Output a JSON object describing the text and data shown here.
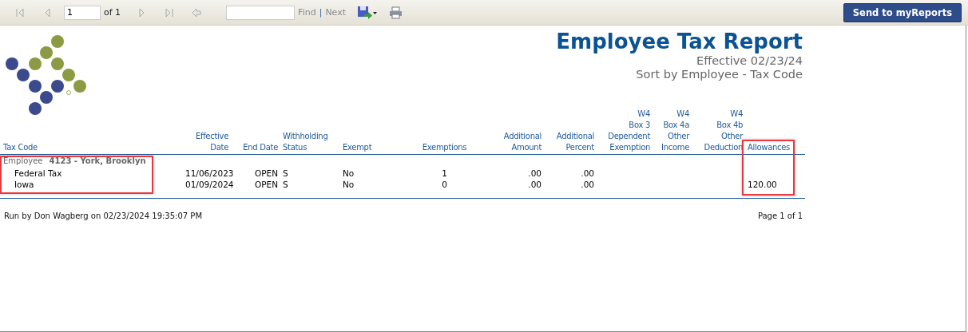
{
  "toolbar": {
    "nav": [
      {
        "kind": "first",
        "disabled": true
      },
      {
        "kind": "prev",
        "disabled": true
      }
    ],
    "page_field": {
      "value": "1"
    },
    "page_count": "of 1",
    "nav_after": [
      {
        "kind": "next",
        "disabled": true
      },
      {
        "kind": "last",
        "disabled": true
      },
      {
        "kind": "back",
        "disabled": true
      }
    ],
    "find": "Find",
    "separator": "|",
    "next": "Next",
    "send_button": "Send to myReports"
  },
  "report": {
    "title": "Employee Tax Report",
    "subtitles": [
      "Effective 02/23/24",
      "Sort by Employee - Tax Code"
    ],
    "columns": [
      {
        "lines": [
          "Tax Code"
        ]
      },
      {
        "lines": [
          "Effective",
          "Date"
        ]
      },
      {
        "lines": [
          "End Date"
        ]
      },
      {
        "lines": [
          "Withholding",
          "Status"
        ]
      },
      {
        "lines": [
          "Exempt"
        ]
      },
      {
        "lines": [
          "Exemptions"
        ]
      },
      {
        "lines": [
          "Additional",
          "Amount"
        ]
      },
      {
        "lines": [
          "Additional",
          "Percent"
        ]
      },
      {
        "lines": [
          "W4",
          "Box 3",
          "Dependent",
          "Exemption"
        ]
      },
      {
        "lines": [
          "W4",
          "Box 4a",
          "Other",
          "Income"
        ]
      },
      {
        "lines": [
          "W4",
          "Box 4b",
          "Other",
          "Deduction"
        ]
      },
      {
        "lines": [
          "Allowances"
        ]
      }
    ],
    "group": {
      "label": "Employee",
      "value": "4123 - York, Brooklyn"
    },
    "rows": [
      {
        "cells": [
          "Federal Tax",
          "11/06/2023",
          "OPEN",
          "S",
          "No",
          "1",
          ".00",
          ".00",
          null,
          null,
          null,
          null
        ]
      },
      {
        "cells": [
          "Iowa",
          "01/09/2024",
          "OPEN",
          "S",
          "No",
          "0",
          ".00",
          ".00",
          null,
          null,
          null,
          "120.00"
        ]
      }
    ],
    "footer": {
      "run_by": "Run by Don Wagberg on 02/23/2024 19:35:07 PM",
      "page": "Page 1 of 1"
    }
  }
}
